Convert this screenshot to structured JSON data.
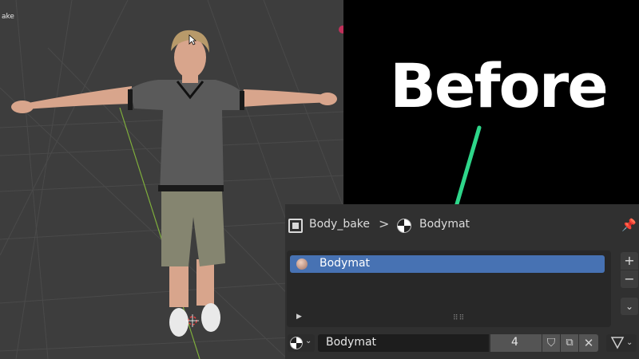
{
  "viewport": {
    "object_label": "ake",
    "colors": {
      "background": "#3d3d3d",
      "grid": "#4a4a4a",
      "y_axis": "#7fae3c"
    }
  },
  "overlay": {
    "title": "Before",
    "arrow_color": "#2ed68a"
  },
  "properties": {
    "breadcrumb": {
      "object_name": "Body_bake",
      "separator": ">",
      "material_name": "Bodymat",
      "object_icon": "object-data-icon",
      "material_icon": "material-icon",
      "pin_icon": "pin-icon"
    },
    "slots": [
      {
        "label": "Bodymat",
        "selected": true
      }
    ],
    "side_buttons": {
      "add": "+",
      "remove": "−",
      "more": "⌄"
    },
    "material_bar": {
      "name_value": "Bodymat",
      "users": "4",
      "fake_user_icon": "shield-icon",
      "copy_icon": "copy-icon",
      "unlink_icon": "close-icon",
      "link_icon": "node-tree-icon"
    },
    "colors": {
      "panel": "#303030",
      "selected_row": "#4772b3",
      "field": "#1d1d1d",
      "button": "#545454"
    }
  }
}
